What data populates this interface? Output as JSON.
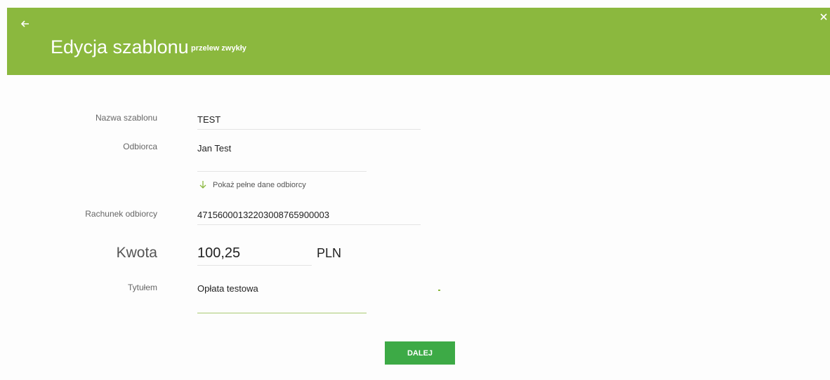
{
  "header": {
    "title": "Edycja szablonu",
    "subtitle": "przelew zwykły",
    "back_icon": "arrow-left-icon",
    "close_icon": "close-icon",
    "color": "#8bb83e"
  },
  "form": {
    "template_name": {
      "label": "Nazwa szablonu",
      "value": "TEST"
    },
    "recipient": {
      "label": "Odbiorca",
      "value": "Jan Test"
    },
    "show_details": {
      "label": "Pokaż pełne dane odbiorcy",
      "icon": "arrow-down-icon"
    },
    "account": {
      "label": "Rachunek odbiorcy",
      "value": "47156000132203008765900003"
    },
    "amount": {
      "label": "Kwota",
      "value": "100,25",
      "currency": "PLN"
    },
    "title": {
      "label": "Tytułem",
      "value": "Opłata testowa"
    }
  },
  "actions": {
    "next_label": "DALEJ",
    "next_color": "#3daa46"
  }
}
